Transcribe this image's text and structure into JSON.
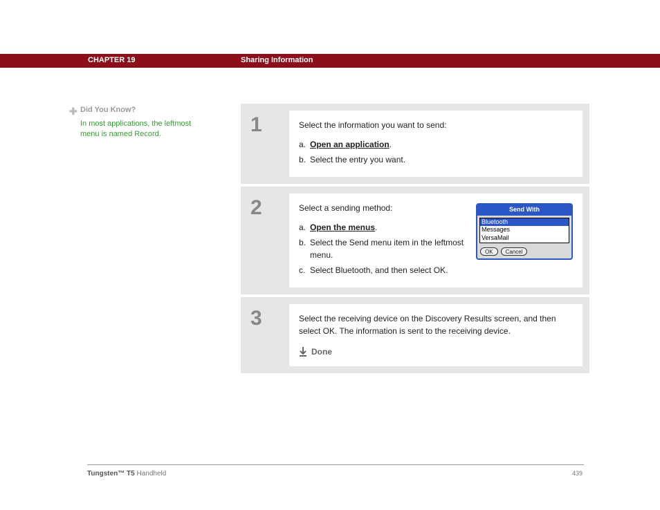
{
  "header": {
    "chapter": "CHAPTER 19",
    "title": "Sharing Information"
  },
  "sidebar": {
    "dyk_title": "Did You Know?",
    "dyk_body": "In most applications, the leftmost menu is named Record."
  },
  "steps": {
    "s1": {
      "num": "1",
      "intro": "Select the information you want to send:",
      "a_label": "a.",
      "a_link": "Open an application",
      "a_suffix": ".",
      "b_label": "b.",
      "b_text": "Select the entry you want."
    },
    "s2": {
      "num": "2",
      "intro": "Select a sending method:",
      "a_label": "a.",
      "a_link": "Open the menus",
      "a_suffix": ".",
      "b_label": "b.",
      "b_text": "Select the Send menu item in the leftmost menu.",
      "c_label": "c.",
      "c_text": "Select Bluetooth, and then select OK.",
      "dialog": {
        "title": "Send With",
        "item1": "Bluetooth",
        "item2": "Messages",
        "item3": "VersaMail",
        "ok": "OK",
        "cancel": "Cancel"
      }
    },
    "s3": {
      "num": "3",
      "text": "Select the receiving device on the Discovery Results screen, and then select OK. The information is sent to the receiving device.",
      "done": "Done"
    }
  },
  "footer": {
    "product_bold": "Tungsten™ T5",
    "product_rest": " Handheld",
    "page": "439"
  }
}
